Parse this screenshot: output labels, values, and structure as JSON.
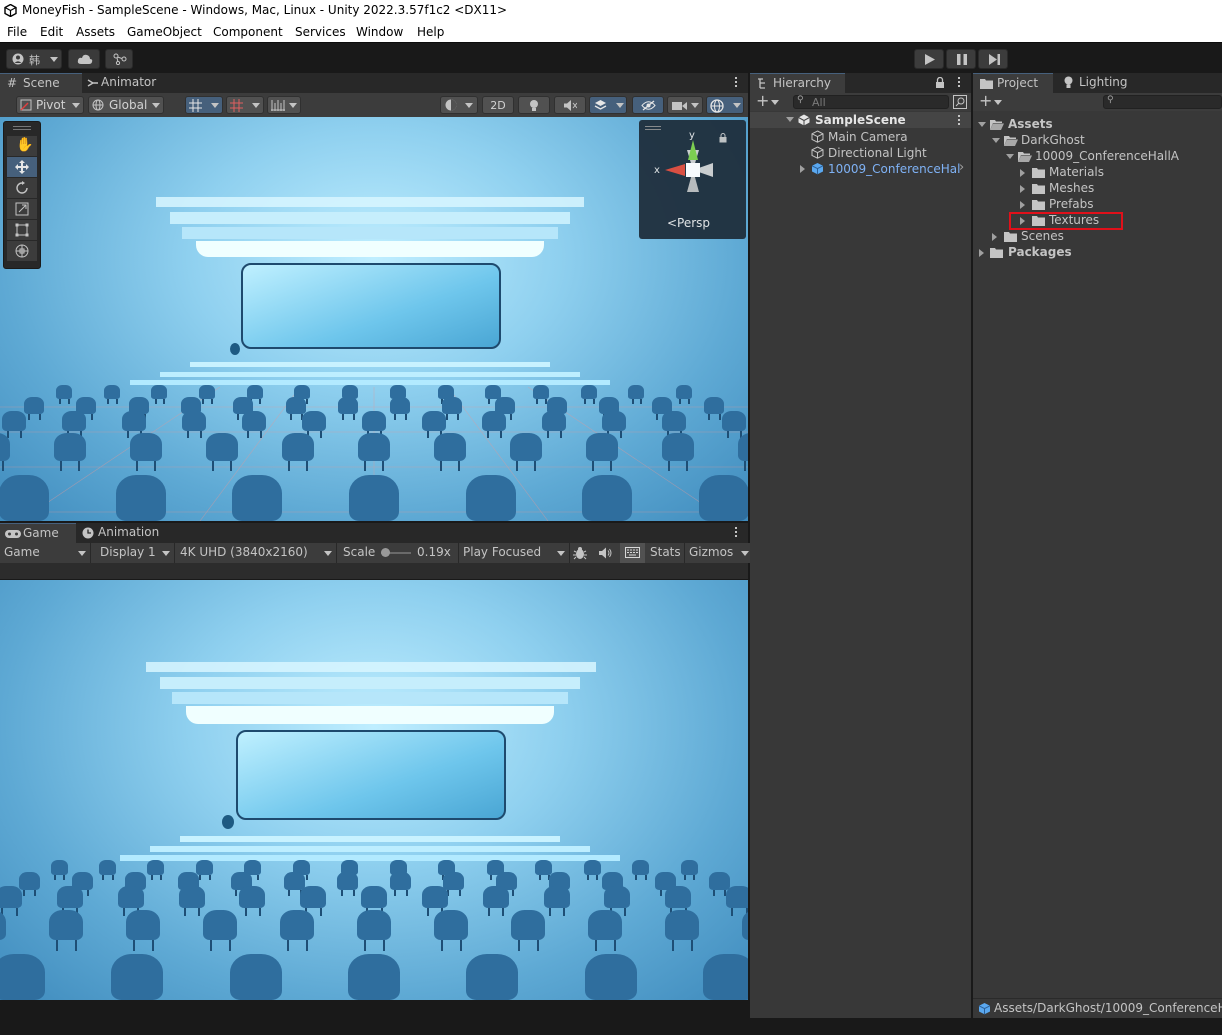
{
  "window": {
    "title": "MoneyFish - SampleScene - Windows, Mac, Linux - Unity 2022.3.57f1c2 <DX11>"
  },
  "menu": [
    "File",
    "Edit",
    "Assets",
    "GameObject",
    "Component",
    "Services",
    "Window",
    "Help"
  ],
  "toolbar": {
    "account_label": "韩",
    "play_icon": "play-icon",
    "pause_icon": "pause-icon",
    "step_icon": "step-icon"
  },
  "scene_panel": {
    "tabs": [
      "Scene",
      "Animator"
    ],
    "pivot_label": "Pivot",
    "global_label": "Global",
    "mode_2d": "2D",
    "gizmo_persp": "<Persp",
    "gizmo_x": "x",
    "gizmo_y": "y"
  },
  "game_panel": {
    "tabs": [
      "Game",
      "Animation"
    ],
    "view_select": "Game",
    "display_select": "Display 1",
    "resolution_select": "4K UHD (3840x2160)",
    "scale_label": "Scale",
    "scale_value": "0.19x",
    "play_mode_select": "Play Focused",
    "stats_label": "Stats",
    "gizmos_label": "Gizmos"
  },
  "hierarchy": {
    "tab": "Hierarchy",
    "search_placeholder": "All",
    "items": [
      {
        "label": "SampleScene",
        "level": 0,
        "expanded": true,
        "kind": "scene"
      },
      {
        "label": "Main Camera",
        "level": 1,
        "kind": "object"
      },
      {
        "label": "Directional Light",
        "level": 1,
        "kind": "object"
      },
      {
        "label": "10009_ConferenceHal",
        "level": 1,
        "kind": "prefab",
        "collapsed": true
      }
    ]
  },
  "project": {
    "tabs": [
      "Project",
      "Lighting"
    ],
    "tree": [
      {
        "label": "Assets",
        "level": 0,
        "state": "open",
        "bold": true
      },
      {
        "label": "DarkGhost",
        "level": 1,
        "state": "open"
      },
      {
        "label": "10009_ConferenceHallA",
        "level": 2,
        "state": "open"
      },
      {
        "label": "Materials",
        "level": 3,
        "state": "closed"
      },
      {
        "label": "Meshes",
        "level": 3,
        "state": "closed"
      },
      {
        "label": "Prefabs",
        "level": 3,
        "state": "closed"
      },
      {
        "label": "Textures",
        "level": 3,
        "state": "closed",
        "highlighted": true
      },
      {
        "label": "Scenes",
        "level": 1,
        "state": "closed"
      },
      {
        "label": "Packages",
        "level": 0,
        "state": "closed",
        "bold": true
      }
    ],
    "path": "Assets/DarkGhost/10009_ConferenceHa"
  },
  "colors": {
    "highlight_box": "#e0101a",
    "prefab_blue": "#7fb2f5",
    "selection_blue": "#46607c"
  }
}
